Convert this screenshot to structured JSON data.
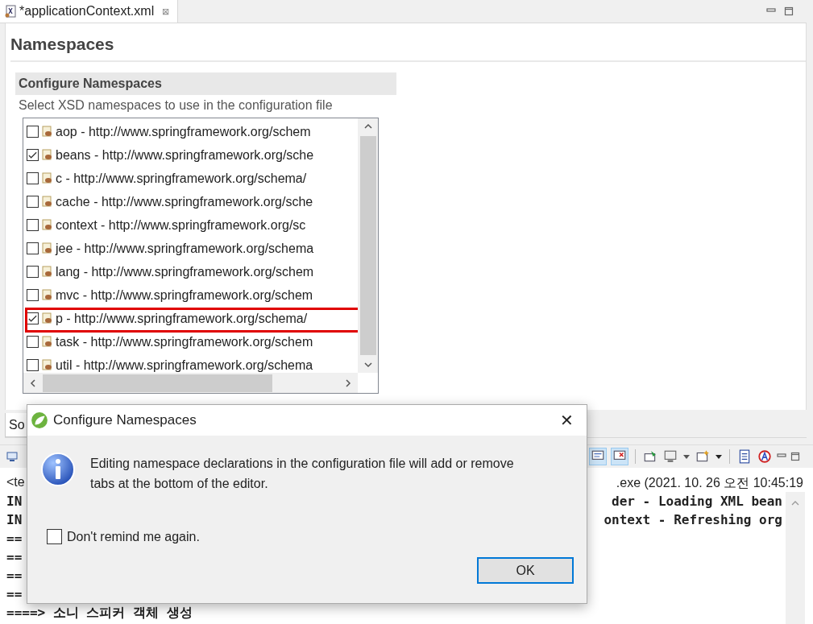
{
  "editor_tab": {
    "title": "*applicationContext.xml",
    "close": "⊠"
  },
  "page": {
    "title": "Namespaces"
  },
  "section": {
    "title": "Configure Namespaces",
    "description": "Select XSD namespaces to use in the configuration file"
  },
  "namespaces": [
    {
      "label": "aop - http://www.springframework.org/schem",
      "checked": false,
      "highlighted": false
    },
    {
      "label": "beans - http://www.springframework.org/sche",
      "checked": true,
      "highlighted": false
    },
    {
      "label": "c - http://www.springframework.org/schema/",
      "checked": false,
      "highlighted": false
    },
    {
      "label": "cache - http://www.springframework.org/sche",
      "checked": false,
      "highlighted": false
    },
    {
      "label": "context - http://www.springframework.org/sc",
      "checked": false,
      "highlighted": false
    },
    {
      "label": "jee - http://www.springframework.org/schema",
      "checked": false,
      "highlighted": false
    },
    {
      "label": "lang - http://www.springframework.org/schem",
      "checked": false,
      "highlighted": false
    },
    {
      "label": "mvc - http://www.springframework.org/schem",
      "checked": false,
      "highlighted": false
    },
    {
      "label": "p - http://www.springframework.org/schema/",
      "checked": true,
      "highlighted": true
    },
    {
      "label": "task - http://www.springframework.org/schem",
      "checked": false,
      "highlighted": false
    },
    {
      "label": "util - http://www.springframework.org/schema",
      "checked": false,
      "highlighted": false
    }
  ],
  "bottom_tabs": [
    "So"
  ],
  "console": {
    "header_left": "<te",
    "header_right": ".exe  (2021. 10. 26 오전 10:45:19",
    "lines": [
      {
        "left": "IN",
        "right": "der - Loading XML bean"
      },
      {
        "left": "IN",
        "right": "ontext - Refreshing org"
      },
      {
        "left": "=="
      },
      {
        "left": "=="
      },
      {
        "left": "=="
      },
      {
        "left": "=="
      },
      {
        "left": "====>  소니 스피커 객체 생성"
      }
    ]
  },
  "dialog": {
    "title": "Configure Namespaces",
    "close": "✕",
    "message": "Editing namespace declarations in the configuration file will add or remove tabs at the bottom of the editor.",
    "checkbox": {
      "label": "Don't remind me again.",
      "checked": false
    },
    "buttons": [
      "OK"
    ]
  }
}
